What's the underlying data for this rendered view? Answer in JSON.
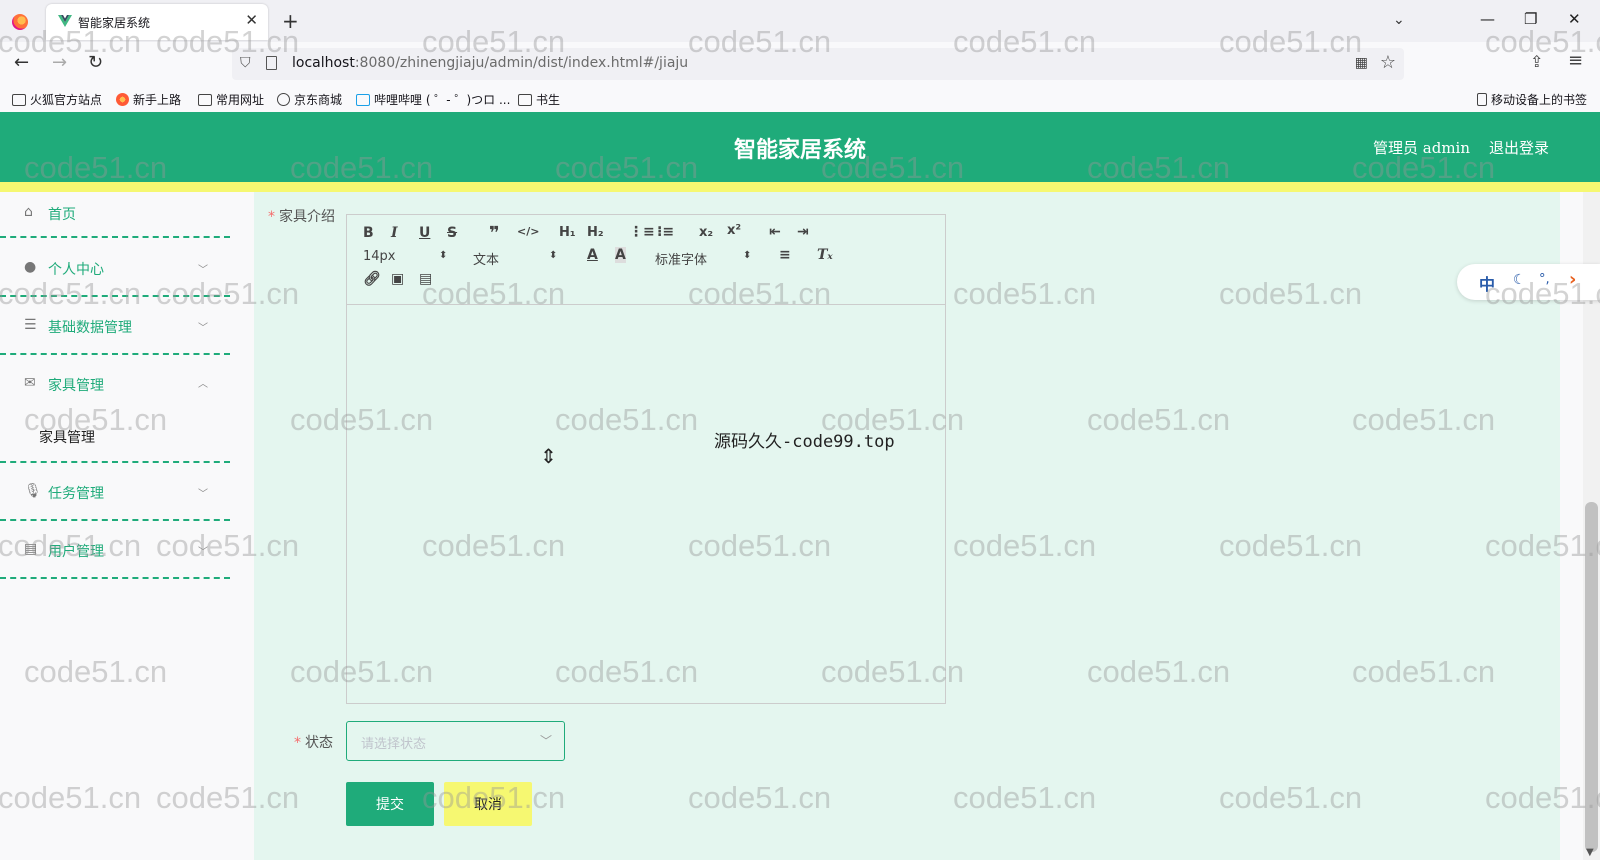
{
  "browser": {
    "tab_title": "智能家居系统",
    "tab_close": "✕",
    "new_tab": "+",
    "url_host": "localhost",
    "url_rest": ":8080/zhinengjiaju/admin/dist/index.html#/jiaju",
    "bookmarks": [
      "火狐官方站点",
      "新手上路",
      "常用网址",
      "京东商城",
      "哔哩哔哩 ( ゜- ゜)つロ ...",
      "书生"
    ],
    "mobile_bookmarks": "移动设备上的书签"
  },
  "app": {
    "title": "智能家居系统",
    "user": "管理员 admin",
    "logout": "退出登录"
  },
  "sidebar": {
    "items": [
      {
        "label": "首页",
        "icon": "home-icon"
      },
      {
        "label": "个人中心",
        "icon": "user-icon"
      },
      {
        "label": "基础数据管理",
        "icon": "sliders-icon"
      },
      {
        "label": "家具管理",
        "icon": "mail-icon"
      },
      {
        "label": "任务管理",
        "icon": "microphone-icon"
      },
      {
        "label": "用户管理",
        "icon": "card-icon"
      }
    ],
    "submenu_label": "家具管理"
  },
  "form": {
    "intro_label": "家具介绍",
    "editor_content": "源码久久-code99.top",
    "font_size": "14px",
    "text_style": "文本",
    "font_family": "标准字体",
    "status_label": "状态",
    "status_placeholder": "请选择状态",
    "submit": "提交",
    "cancel": "取消",
    "required_mark": "*"
  },
  "ime": {
    "lang": "中"
  },
  "watermark": "code51.cn",
  "colors": {
    "primary": "#1fab7a",
    "accent": "#f6f871",
    "background": "#e4f6ef"
  }
}
